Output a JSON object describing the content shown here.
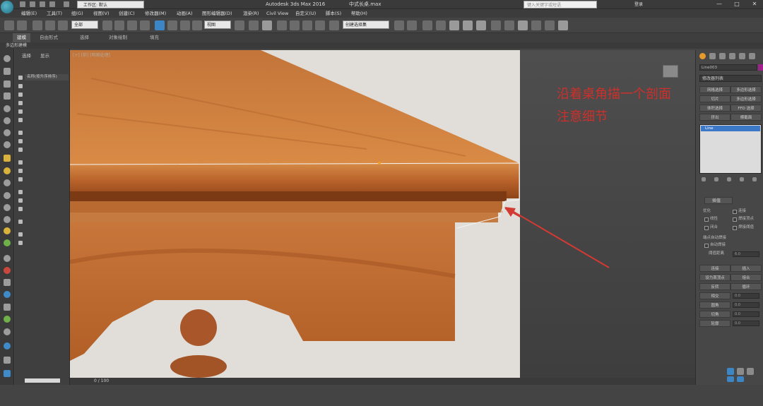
{
  "titlebar": {
    "workspace": "工作区: 默认",
    "app_title": "Autodesk 3ds Max 2016",
    "file_name": "中式长桌.max",
    "search_placeholder": "键入关键字或短语",
    "login": "登录",
    "minimize": "—",
    "maximize": "□",
    "close": "✕"
  },
  "menu": [
    "编辑(E)",
    "工具(T)",
    "组(G)",
    "视图(V)",
    "创建(C)",
    "修改器(M)",
    "动画(A)",
    "图形编辑器(D)",
    "渲染(R)",
    "Civil View",
    "自定义(U)",
    "脚本(S)",
    "帮助(H)"
  ],
  "toolbar": {
    "selection_filter": "全部",
    "ref_coord": "视图",
    "named_selection": "创建选择集"
  },
  "ribbon": {
    "tabs": [
      "建模",
      "自由形式",
      "选择",
      "对象绘制",
      "填充"
    ],
    "active": 0,
    "sub_label": "多边形建模"
  },
  "scene_panel": {
    "tabs": [
      "选择",
      "显示"
    ],
    "header": "名称(按升序排序)"
  },
  "viewport": {
    "label": "[+] [前] [明暗处理]"
  },
  "annotation": {
    "line1": "沿着桌角描一个剖面",
    "line2": "注意细节"
  },
  "timeline": {
    "frame": "0 / 100"
  },
  "command_panel": {
    "object_name": "Line003",
    "modifier_list": "修改器列表",
    "buttons": [
      "网格选择",
      "多边形选择",
      "切片",
      "多边形选择",
      "体积选择",
      "FFD 选择",
      "挤出",
      "横截面",
      "车削",
      "曲面选择"
    ],
    "stack_item": "Line",
    "rollout_title": "插值",
    "checks": {
      "optimize": "优化",
      "connect": "连接",
      "linear": "线性",
      "weld_vertices": "焊接顶点",
      "closed": "闭合",
      "weld_threshold": "焊接阈值"
    },
    "auto_weld_title": "端点自动焊接",
    "auto_weld": "自动焊接",
    "threshold_label": "阈值距离",
    "threshold_value": "6.0",
    "bottom_buttons": [
      "连接",
      "插入",
      "设为首顶点",
      "熔合",
      "反转",
      "循环",
      "相交",
      "圆角",
      "切角",
      "轮廓"
    ],
    "spin_value": "0.0"
  }
}
